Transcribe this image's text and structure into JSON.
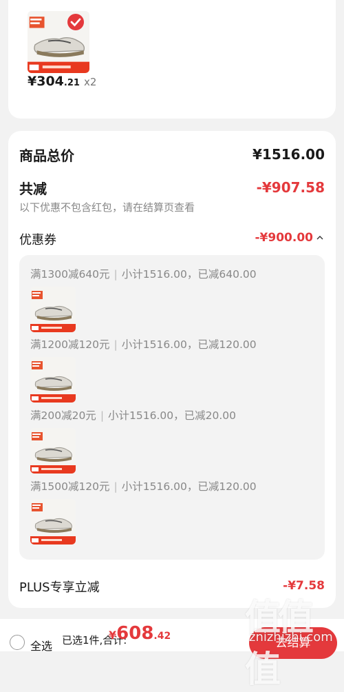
{
  "product": {
    "price_main": "¥304",
    "price_decimal": ".21",
    "quantity": "x2",
    "image_icon": "mizuno-running-shoe-thumbnail",
    "checked_icon": "checkmark-icon"
  },
  "summary": {
    "total_label": "商品总价",
    "total_value": "¥1516.00",
    "discount_label": "共减",
    "discount_value": "-¥907.58",
    "note": "以下优惠不包含红包，请在结算页查看",
    "coupon_label": "优惠券",
    "coupon_value": "-¥900.00",
    "coupon_expand_icon": "chevron-up-icon",
    "plus_label": "PLUS专享立减",
    "plus_value": "-¥7.58"
  },
  "coupon_groups": [
    {
      "rule": "满1300减640元",
      "detail": "小计1516.00，已减640.00"
    },
    {
      "rule": "满1200减120元",
      "detail": "小计1516.00，已减120.00"
    },
    {
      "rule": "满200减20元",
      "detail": "小计1516.00，已减20.00"
    },
    {
      "rule": "满1500减120元",
      "detail": "小计1516.00，已减120.00"
    }
  ],
  "footer": {
    "select_all": "全选",
    "selected_text": "已选1件,合计:",
    "total_currency": "¥",
    "total_int": "608",
    "total_dec": ".42",
    "checkout_label": "去结算"
  },
  "watermark": {
    "logo": "值值值",
    "url": "znizhizhi.com"
  },
  "colors": {
    "accent_red": "#e4393c",
    "page_bg": "#f2f2f2"
  }
}
